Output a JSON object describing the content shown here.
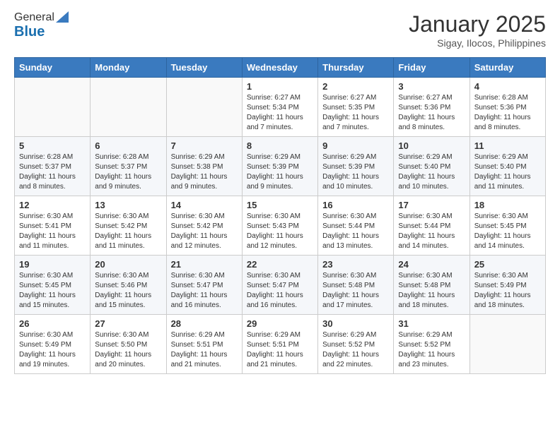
{
  "header": {
    "logo_line1": "General",
    "logo_line2": "Blue",
    "title": "January 2025",
    "subtitle": "Sigay, Ilocos, Philippines"
  },
  "calendar": {
    "days_of_week": [
      "Sunday",
      "Monday",
      "Tuesday",
      "Wednesday",
      "Thursday",
      "Friday",
      "Saturday"
    ],
    "weeks": [
      [
        {
          "day": "",
          "info": ""
        },
        {
          "day": "",
          "info": ""
        },
        {
          "day": "",
          "info": ""
        },
        {
          "day": "1",
          "info": "Sunrise: 6:27 AM\nSunset: 5:34 PM\nDaylight: 11 hours and 7 minutes."
        },
        {
          "day": "2",
          "info": "Sunrise: 6:27 AM\nSunset: 5:35 PM\nDaylight: 11 hours and 7 minutes."
        },
        {
          "day": "3",
          "info": "Sunrise: 6:27 AM\nSunset: 5:36 PM\nDaylight: 11 hours and 8 minutes."
        },
        {
          "day": "4",
          "info": "Sunrise: 6:28 AM\nSunset: 5:36 PM\nDaylight: 11 hours and 8 minutes."
        }
      ],
      [
        {
          "day": "5",
          "info": "Sunrise: 6:28 AM\nSunset: 5:37 PM\nDaylight: 11 hours and 8 minutes."
        },
        {
          "day": "6",
          "info": "Sunrise: 6:28 AM\nSunset: 5:37 PM\nDaylight: 11 hours and 9 minutes."
        },
        {
          "day": "7",
          "info": "Sunrise: 6:29 AM\nSunset: 5:38 PM\nDaylight: 11 hours and 9 minutes."
        },
        {
          "day": "8",
          "info": "Sunrise: 6:29 AM\nSunset: 5:39 PM\nDaylight: 11 hours and 9 minutes."
        },
        {
          "day": "9",
          "info": "Sunrise: 6:29 AM\nSunset: 5:39 PM\nDaylight: 11 hours and 10 minutes."
        },
        {
          "day": "10",
          "info": "Sunrise: 6:29 AM\nSunset: 5:40 PM\nDaylight: 11 hours and 10 minutes."
        },
        {
          "day": "11",
          "info": "Sunrise: 6:29 AM\nSunset: 5:40 PM\nDaylight: 11 hours and 11 minutes."
        }
      ],
      [
        {
          "day": "12",
          "info": "Sunrise: 6:30 AM\nSunset: 5:41 PM\nDaylight: 11 hours and 11 minutes."
        },
        {
          "day": "13",
          "info": "Sunrise: 6:30 AM\nSunset: 5:42 PM\nDaylight: 11 hours and 11 minutes."
        },
        {
          "day": "14",
          "info": "Sunrise: 6:30 AM\nSunset: 5:42 PM\nDaylight: 11 hours and 12 minutes."
        },
        {
          "day": "15",
          "info": "Sunrise: 6:30 AM\nSunset: 5:43 PM\nDaylight: 11 hours and 12 minutes."
        },
        {
          "day": "16",
          "info": "Sunrise: 6:30 AM\nSunset: 5:44 PM\nDaylight: 11 hours and 13 minutes."
        },
        {
          "day": "17",
          "info": "Sunrise: 6:30 AM\nSunset: 5:44 PM\nDaylight: 11 hours and 14 minutes."
        },
        {
          "day": "18",
          "info": "Sunrise: 6:30 AM\nSunset: 5:45 PM\nDaylight: 11 hours and 14 minutes."
        }
      ],
      [
        {
          "day": "19",
          "info": "Sunrise: 6:30 AM\nSunset: 5:45 PM\nDaylight: 11 hours and 15 minutes."
        },
        {
          "day": "20",
          "info": "Sunrise: 6:30 AM\nSunset: 5:46 PM\nDaylight: 11 hours and 15 minutes."
        },
        {
          "day": "21",
          "info": "Sunrise: 6:30 AM\nSunset: 5:47 PM\nDaylight: 11 hours and 16 minutes."
        },
        {
          "day": "22",
          "info": "Sunrise: 6:30 AM\nSunset: 5:47 PM\nDaylight: 11 hours and 16 minutes."
        },
        {
          "day": "23",
          "info": "Sunrise: 6:30 AM\nSunset: 5:48 PM\nDaylight: 11 hours and 17 minutes."
        },
        {
          "day": "24",
          "info": "Sunrise: 6:30 AM\nSunset: 5:48 PM\nDaylight: 11 hours and 18 minutes."
        },
        {
          "day": "25",
          "info": "Sunrise: 6:30 AM\nSunset: 5:49 PM\nDaylight: 11 hours and 18 minutes."
        }
      ],
      [
        {
          "day": "26",
          "info": "Sunrise: 6:30 AM\nSunset: 5:49 PM\nDaylight: 11 hours and 19 minutes."
        },
        {
          "day": "27",
          "info": "Sunrise: 6:30 AM\nSunset: 5:50 PM\nDaylight: 11 hours and 20 minutes."
        },
        {
          "day": "28",
          "info": "Sunrise: 6:29 AM\nSunset: 5:51 PM\nDaylight: 11 hours and 21 minutes."
        },
        {
          "day": "29",
          "info": "Sunrise: 6:29 AM\nSunset: 5:51 PM\nDaylight: 11 hours and 21 minutes."
        },
        {
          "day": "30",
          "info": "Sunrise: 6:29 AM\nSunset: 5:52 PM\nDaylight: 11 hours and 22 minutes."
        },
        {
          "day": "31",
          "info": "Sunrise: 6:29 AM\nSunset: 5:52 PM\nDaylight: 11 hours and 23 minutes."
        },
        {
          "day": "",
          "info": ""
        }
      ]
    ]
  }
}
